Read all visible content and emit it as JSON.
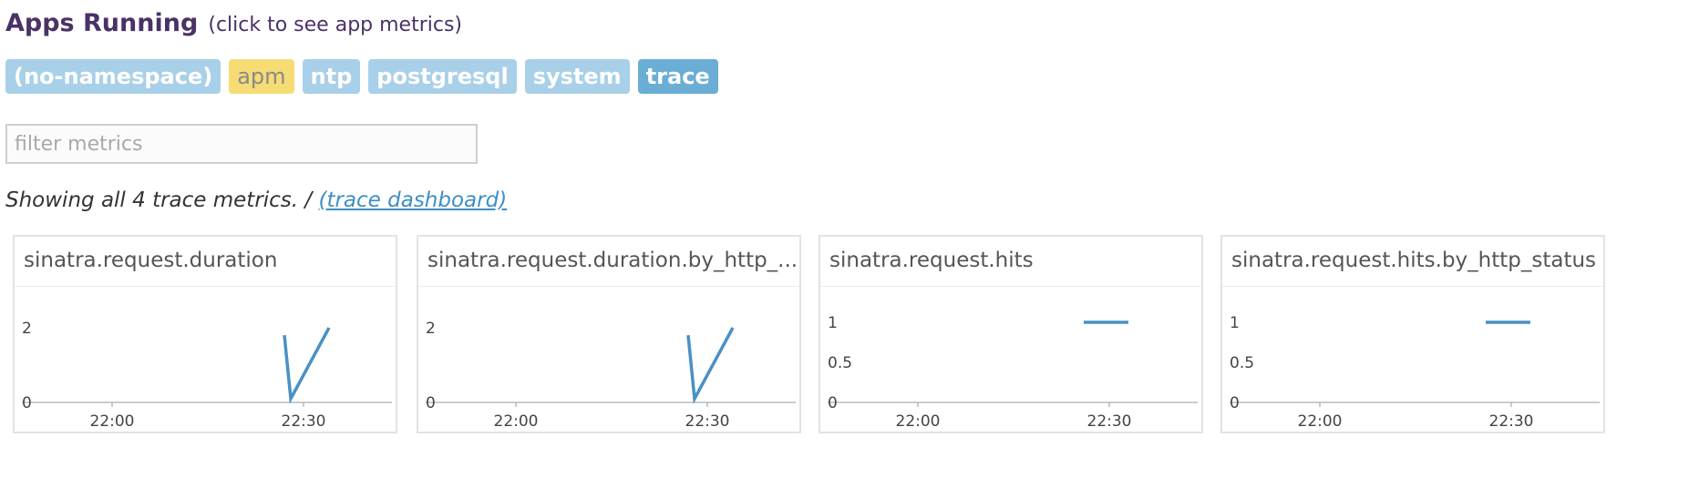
{
  "header": {
    "title": "Apps Running",
    "subtitle": "(click to see app metrics)"
  },
  "namespaces": [
    {
      "label": "(no-namespace)",
      "state": "default"
    },
    {
      "label": "apm",
      "state": "highlighted"
    },
    {
      "label": "ntp",
      "state": "default"
    },
    {
      "label": "postgresql",
      "state": "default"
    },
    {
      "label": "system",
      "state": "default"
    },
    {
      "label": "trace",
      "state": "selected"
    }
  ],
  "filter": {
    "placeholder": "filter metrics",
    "value": ""
  },
  "summary": {
    "text": "Showing all 4 trace metrics. / ",
    "link_label": "(trace dashboard)"
  },
  "colors": {
    "series": "#4a90c4",
    "title": "#4a3266",
    "tag_default": "#a8d0e8",
    "tag_selected": "#6aaed6",
    "tag_highlight": "#f6dc74"
  },
  "charts": [
    {
      "title": "sinatra.request.duration",
      "chart_data": {
        "type": "line",
        "x_ticks": [
          "22:00",
          "22:30"
        ],
        "y_ticks": [
          "0",
          "2"
        ],
        "series": [
          {
            "x": [
              "22:27",
              "22:28",
              "22:34"
            ],
            "y": [
              1.8,
              0.1,
              2.0
            ]
          }
        ]
      }
    },
    {
      "title": "sinatra.request.duration.by_http_...",
      "chart_data": {
        "type": "line",
        "x_ticks": [
          "22:00",
          "22:30"
        ],
        "y_ticks": [
          "0",
          "2"
        ],
        "series": [
          {
            "x": [
              "22:27",
              "22:28",
              "22:34"
            ],
            "y": [
              1.8,
              0.1,
              2.0
            ]
          }
        ]
      }
    },
    {
      "title": "sinatra.request.hits",
      "chart_data": {
        "type": "line",
        "x_ticks": [
          "22:00",
          "22:30"
        ],
        "y_ticks": [
          "0",
          "0.5",
          "1"
        ],
        "series": [
          {
            "x": [
              "22:26",
              "22:33"
            ],
            "y": [
              1,
              1
            ]
          }
        ]
      }
    },
    {
      "title": "sinatra.request.hits.by_http_status",
      "chart_data": {
        "type": "line",
        "x_ticks": [
          "22:00",
          "22:30"
        ],
        "y_ticks": [
          "0",
          "0.5",
          "1"
        ],
        "series": [
          {
            "x": [
              "22:26",
              "22:33"
            ],
            "y": [
              1,
              1
            ]
          }
        ]
      }
    }
  ]
}
